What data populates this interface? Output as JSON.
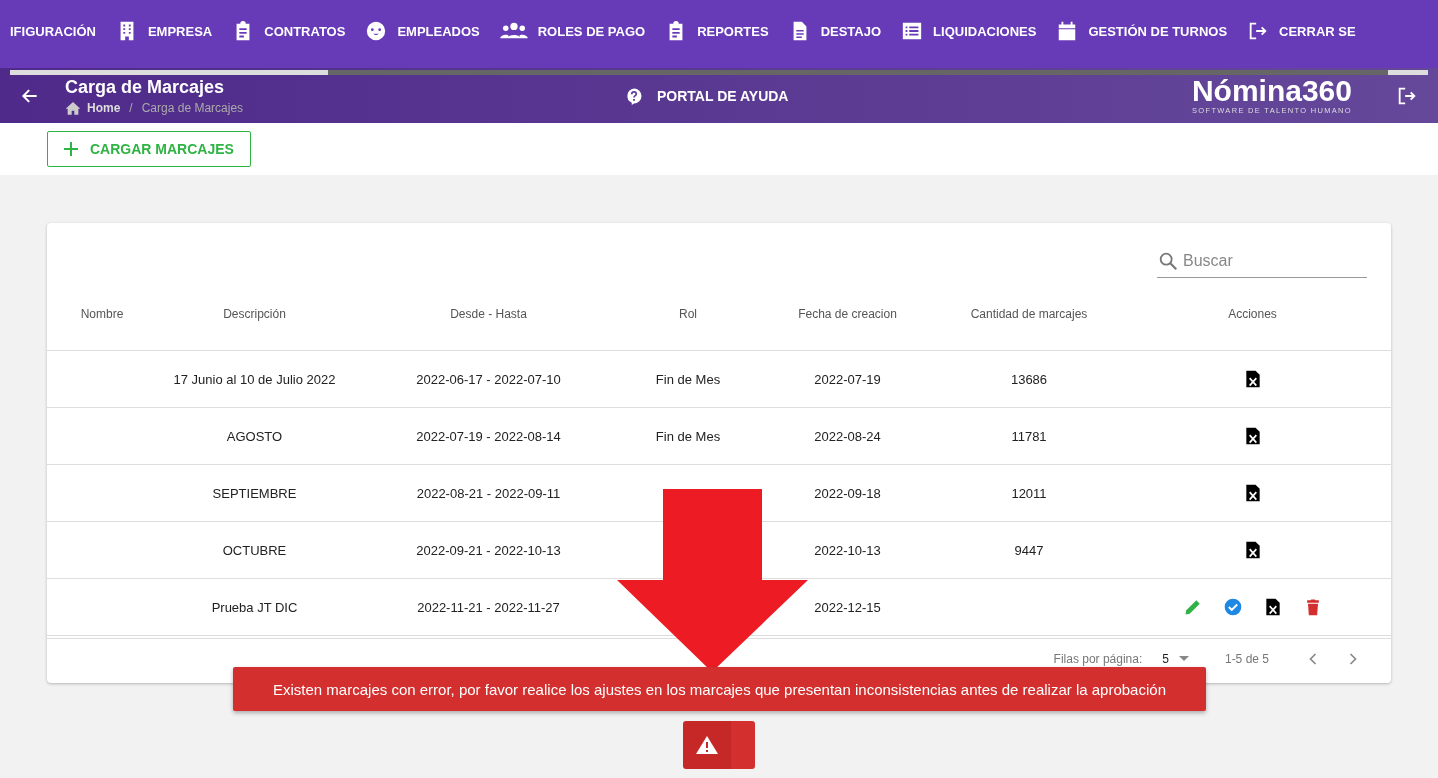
{
  "nav": [
    {
      "label": "IFIGURACIÓN",
      "kind": "none"
    },
    {
      "label": "EMPRESA",
      "kind": "building"
    },
    {
      "label": "CONTRATOS",
      "kind": "clipboard"
    },
    {
      "label": "EMPLEADOS",
      "kind": "face"
    },
    {
      "label": "ROLES DE PAGO",
      "kind": "group"
    },
    {
      "label": "REPORTES",
      "kind": "clipboard"
    },
    {
      "label": "DESTAJO",
      "kind": "document"
    },
    {
      "label": "LIQUIDACIONES",
      "kind": "list"
    },
    {
      "label": "GESTIÓN DE TURNOS",
      "kind": "calendar"
    },
    {
      "label": "CERRAR SE",
      "kind": "logout"
    }
  ],
  "header": {
    "title": "Carga de Marcajes",
    "breadcrumb": [
      "Home",
      "/",
      "Carga de Marcajes"
    ],
    "help": "PORTAL DE AYUDA",
    "logo": "Nómina360",
    "logo_tagline": "SOFTWARE DE TALENTO HUMANO"
  },
  "toolbar": {
    "button": "CARGAR MARCAJES"
  },
  "table": {
    "search": {
      "placeholder": "Buscar"
    },
    "columns": [
      "Nombre",
      "Descripción",
      "Desde - Hasta",
      "Rol",
      "Fecha de creacion",
      "Cantidad de marcajes",
      "Acciones"
    ],
    "rows": [
      {
        "descripcion": "17 Junio al 10 de Julio 2022",
        "rango": "2022-06-17 - 2022-07-10",
        "rol": "Fin de Mes",
        "fecha": "2022-07-19",
        "cantidad": "13686",
        "actions": [
          {
            "kind": "excel"
          }
        ]
      },
      {
        "descripcion": "AGOSTO",
        "rango": "2022-07-19 - 2022-08-14",
        "rol": "Fin de Mes",
        "fecha": "2022-08-24",
        "cantidad": "11781",
        "actions": [
          {
            "kind": "excel"
          }
        ]
      },
      {
        "descripcion": "SEPTIEMBRE",
        "rango": "2022-08-21 - 2022-09-11",
        "fecha": "2022-09-18",
        "cantidad": "12011",
        "actions": [
          {
            "kind": "excel"
          }
        ]
      },
      {
        "descripcion": "OCTUBRE",
        "rango": "2022-09-21 - 2022-10-13",
        "fecha": "2022-10-13",
        "cantidad": "9447",
        "actions": [
          {
            "kind": "excel"
          }
        ]
      },
      {
        "descripcion": "Prueba JT DIC",
        "rango": "2022-11-21 - 2022-11-27",
        "fecha": "2022-12-15",
        "actions": [
          {
            "kind": "edit"
          },
          {
            "kind": "approve"
          },
          {
            "kind": "excel"
          },
          {
            "kind": "delete"
          }
        ]
      }
    ],
    "footer": {
      "rows_label": "Filas por página:",
      "rows_value": "5",
      "range": "1-5 de 5"
    }
  },
  "snackbar": {
    "message": "Existen marcajes con error, por favor realice los ajustes en los marcajes que presentan inconsistencias antes de realizar la aprobación"
  }
}
